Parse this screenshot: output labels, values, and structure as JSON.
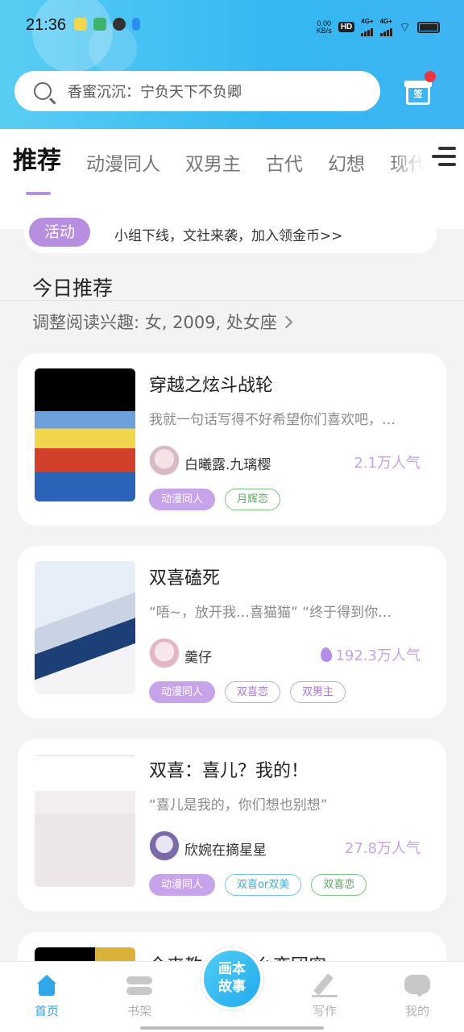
{
  "status": {
    "time": "21:36",
    "net_speed_top": "0.00",
    "net_speed_unit": "KB/s",
    "hd": "HD",
    "sim1": "4G+",
    "sim2": "4G+"
  },
  "search": {
    "placeholder": "香蜜沉沉：宁负天下不负卿"
  },
  "gift": {
    "label": "签",
    "icon": "gift-icon"
  },
  "tabs": [
    "推荐",
    "动漫同人",
    "双男主",
    "古代",
    "幻想",
    "现代"
  ],
  "activity": {
    "badge": "活动",
    "text": "小组下线，文社来袭，加入领金币>>"
  },
  "today": {
    "title": "今日推荐",
    "interest": "调整阅读兴趣: 女, 2009, 处女座"
  },
  "cards": [
    {
      "title": "穿越之炫斗战轮",
      "desc": "我就一句话写得不好希望你们喜欢吧，…",
      "author": "白曦露.九璃樱",
      "popularity": "2.1万人气",
      "tags": [
        "动漫同人",
        "月辉恋"
      ]
    },
    {
      "title": "双喜磕死",
      "desc": "“唔~，放开我…喜猫猫” “终于得到你…",
      "author": "羹仔",
      "popularity": "192.3万人气",
      "tags": [
        "动漫同人",
        "双喜恋",
        "双男主"
      ]
    },
    {
      "title": "双喜：喜儿？我的！",
      "desc": "“喜儿是我的，你们想也别想”",
      "author": "欣婉在摘星星",
      "popularity": "27.8万人气",
      "tags": [
        "动漫同人",
        "双喜or双美",
        "双喜恋"
      ]
    },
    {
      "title": "全来教一下怎么恋团宠"
    }
  ],
  "nav": {
    "home": "首页",
    "shelf": "书架",
    "center": "画本故事",
    "center_line1": "画本",
    "center_line2": "故事",
    "write": "写作",
    "mine": "我的"
  },
  "colors": {
    "accent": "#2fa7ea",
    "purple": "#b88ee0"
  }
}
